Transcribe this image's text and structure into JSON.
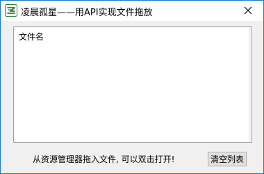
{
  "window": {
    "title": "凌晨孤星——用API实现文件拖放",
    "app_icon": "app-logo-icon",
    "close_icon": "close-icon"
  },
  "file_list": {
    "column_header": "文件名",
    "items": []
  },
  "footer": {
    "hint_text": "从资源管理器拖入文件, 可以双击打开!",
    "clear_button_label": "清空列表"
  },
  "colors": {
    "window_border": "#1979ca",
    "background": "#f0f0f0",
    "icon_green": "#2e7d32"
  }
}
